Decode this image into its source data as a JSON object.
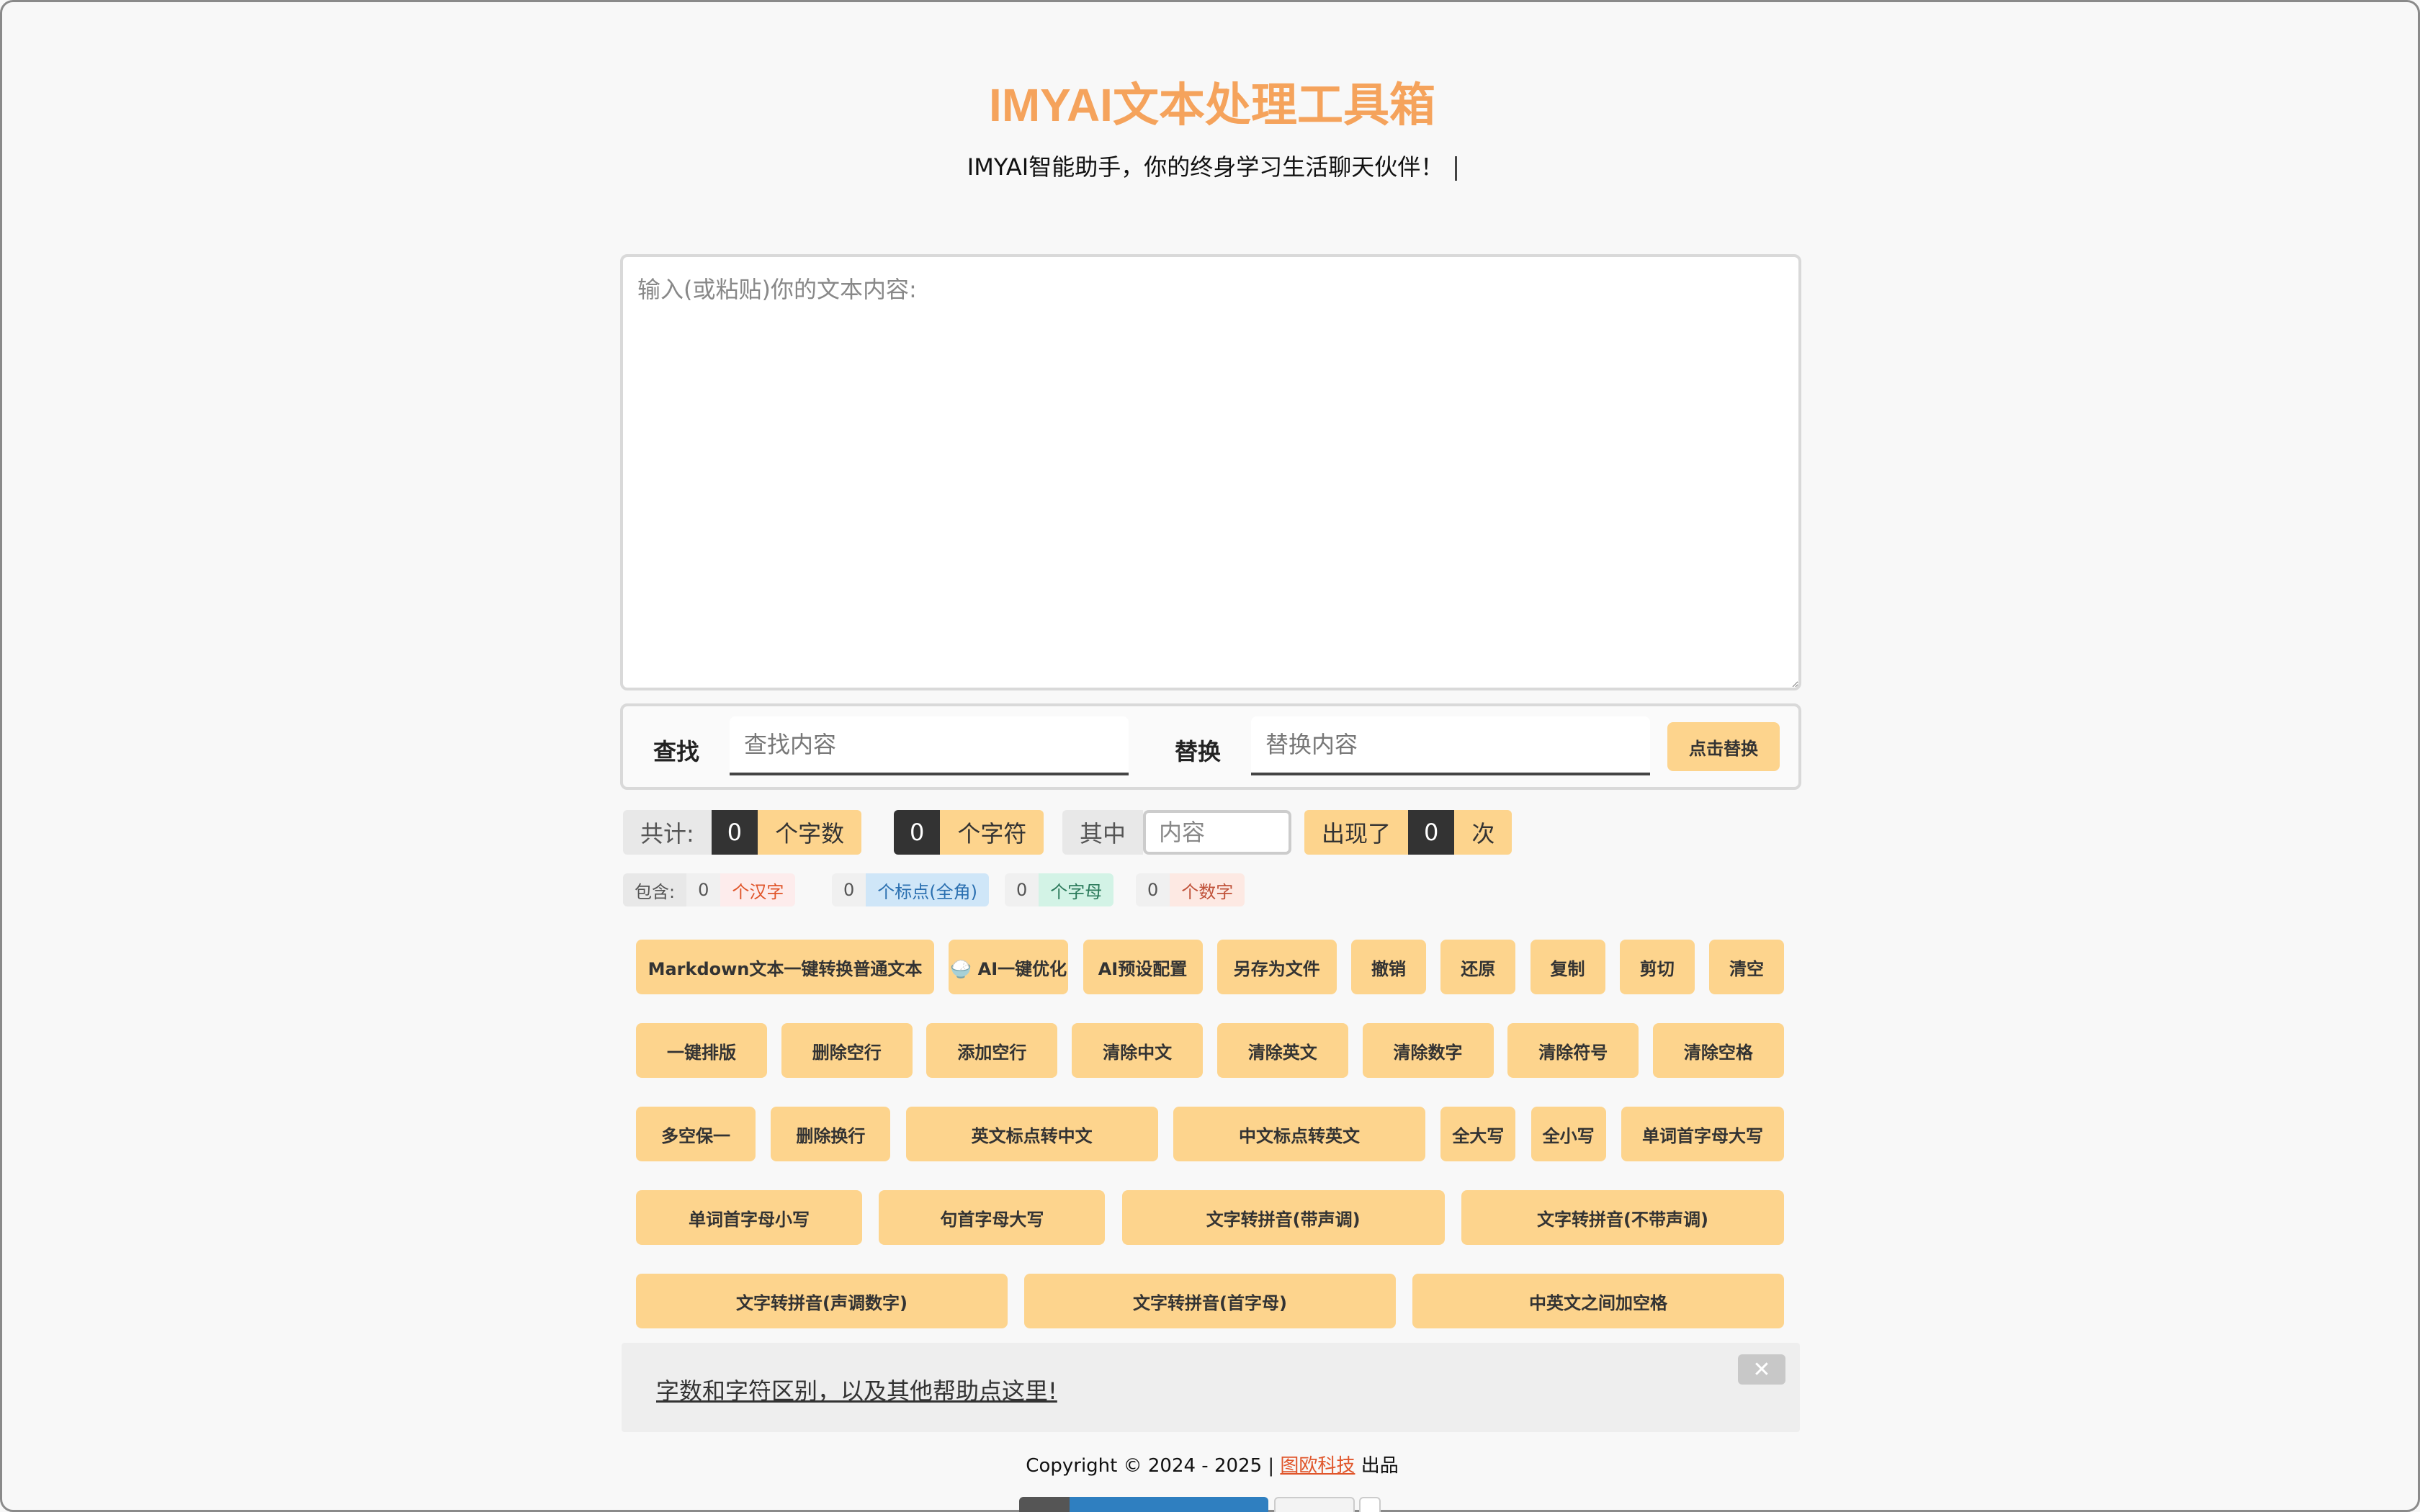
{
  "header": {
    "title": "IMYAI文本处理工具箱",
    "subtitle": "IMYAI智能助手，你的终身学习生活聊天伙伴！"
  },
  "editor": {
    "placeholder": "输入(或粘贴)你的文本内容:",
    "value": ""
  },
  "find_replace": {
    "find_label": "查找",
    "find_placeholder": "查找内容",
    "replace_label": "替换",
    "replace_placeholder": "替换内容",
    "replace_button": "点击替换"
  },
  "stats": {
    "total_label": "共计:",
    "char_count": "0",
    "char_count_unit": "个字数",
    "symbol_count": "0",
    "symbol_count_unit": "个字符",
    "among_label": "其中",
    "among_placeholder": "内容",
    "appears_label": "出现了",
    "appears_count": "0",
    "appears_unit": "次"
  },
  "contains": {
    "label": "包含:",
    "items": [
      {
        "count": "0",
        "unit": "个汉字",
        "color": "#e0552a",
        "bg": "#fdecec"
      },
      {
        "count": "0",
        "unit": "个标点(全角)",
        "color": "#2a6fb0",
        "bg": "#cfe6f8"
      },
      {
        "count": "0",
        "unit": "个字母",
        "color": "#2b7a5b",
        "bg": "#d3f3e6"
      },
      {
        "count": "0",
        "unit": "个数字",
        "color": "#c0523a",
        "bg": "#fde9e3"
      }
    ]
  },
  "buttons": {
    "row1": [
      "Markdown文本一键转换普通文本",
      "🍚 AI一键优化",
      "AI预设配置",
      "另存为文件",
      "撤销",
      "还原",
      "复制",
      "剪切",
      "清空"
    ],
    "row2": [
      "一键排版",
      "删除空行",
      "添加空行",
      "清除中文",
      "清除英文",
      "清除数字",
      "清除符号",
      "清除空格"
    ],
    "row3": [
      "多空保一",
      "删除换行",
      "英文标点转中文",
      "中文标点转英文",
      "全大写",
      "全小写",
      "单词首字母大写"
    ],
    "row4": [
      "单词首字母小写",
      "句首字母大写",
      "文字转拼音(带声调)",
      "文字转拼音(不带声调)"
    ],
    "row5": [
      "文字转拼音(声调数字)",
      "文字转拼音(首字母)",
      "中英文之间加空格"
    ]
  },
  "help": {
    "link_text": "字数和字符区别，以及其他帮助点这里!",
    "close": "✕"
  },
  "footer": {
    "copyright": "Copyright © 2024 - 2025 |",
    "company": "图欧科技",
    "suffix": "出品"
  },
  "colors": {
    "accent": "#f5a35c",
    "button": "#fdd48d",
    "dark": "#333333"
  }
}
